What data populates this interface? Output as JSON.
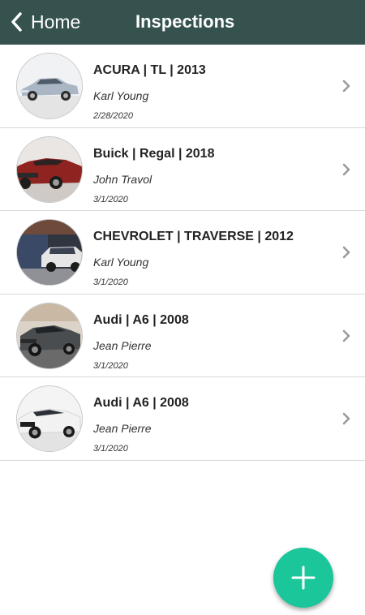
{
  "header": {
    "back_label": "Home",
    "title": "Inspections",
    "back_icon": "chevron-left-icon",
    "background_color": "#35524f"
  },
  "inspections": [
    {
      "title": "ACURA | TL | 2013",
      "inspector": "Karl Young",
      "date": "2/28/2020",
      "car_color": "#aab6c4"
    },
    {
      "title": "Buick | Regal | 2018",
      "inspector": "John Travol",
      "date": "3/1/2020",
      "car_color": "#8e2320"
    },
    {
      "title": "CHEVROLET | TRAVERSE | 2012",
      "inspector": "Karl Young",
      "date": "3/1/2020",
      "car_color": "#e6e6e6"
    },
    {
      "title": "Audi | A6 | 2008",
      "inspector": "Jean Pierre",
      "date": "3/1/2020",
      "car_color": "#4a4d50"
    },
    {
      "title": "Audi | A6 | 2008",
      "inspector": "Jean Pierre",
      "date": "3/1/2020",
      "car_color": "#f2f2f2"
    }
  ],
  "fab": {
    "icon": "plus-icon",
    "color": "#1bc69a"
  },
  "chevron_icon": "chevron-right-icon"
}
